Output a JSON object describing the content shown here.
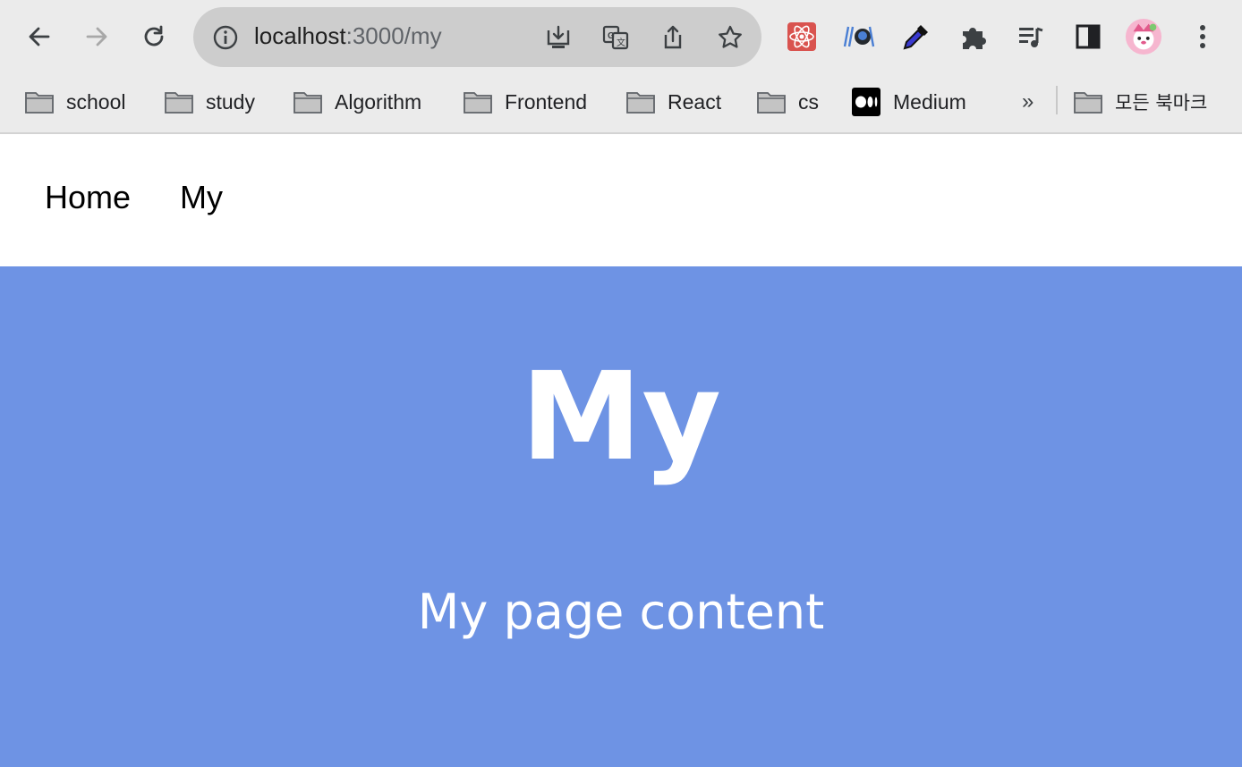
{
  "browser": {
    "url_host": "localhost",
    "url_rest": ":3000/my",
    "icons": {
      "back": "arrow-left-icon",
      "forward": "arrow-right-icon",
      "reload": "reload-icon",
      "site_info": "info-icon",
      "install": "install-app-icon",
      "translate": "translate-icon",
      "share": "share-icon",
      "bookmark": "star-icon"
    },
    "extensions": [
      "react-devtools-icon",
      "github-extension-icon",
      "color-picker-icon",
      "puzzle-icon",
      "media-control-icon",
      "side-panel-icon",
      "profile-avatar",
      "more-menu-icon"
    ]
  },
  "bookmarks": {
    "items": [
      {
        "label": "school",
        "icon": "folder-icon"
      },
      {
        "label": "study",
        "icon": "folder-icon"
      },
      {
        "label": "Algorithm",
        "icon": "folder-icon"
      },
      {
        "label": "Frontend",
        "icon": "folder-icon"
      },
      {
        "label": "React",
        "icon": "folder-icon"
      },
      {
        "label": "cs",
        "icon": "folder-icon"
      },
      {
        "label": "Medium",
        "icon": "medium-icon"
      }
    ],
    "overflow": "»",
    "all_bookmarks": "모든 북마크"
  },
  "nav": {
    "home": "Home",
    "my": "My"
  },
  "hero": {
    "title": "My",
    "content": "My page content",
    "bg_color": "#6e93e4"
  }
}
